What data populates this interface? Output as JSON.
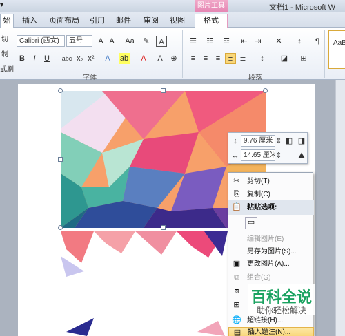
{
  "titlebar": {
    "quick_access": "▾",
    "context_tab": "图片工具",
    "doc_title": "文档1 - Microsoft W"
  },
  "tabs": [
    {
      "label": "始"
    },
    {
      "label": "插入"
    },
    {
      "label": "页面布局"
    },
    {
      "label": "引用"
    },
    {
      "label": "邮件"
    },
    {
      "label": "审阅"
    },
    {
      "label": "视图"
    },
    {
      "label": "格式"
    }
  ],
  "ribbon": {
    "clipboard": {
      "cut": "切",
      "copy": "制",
      "paint": "式刷"
    },
    "font": {
      "name": "Calibri (西文)",
      "size": "五号",
      "group_label": "字体"
    },
    "paragraph": {
      "group_label": "段落"
    },
    "styles": {
      "preview": "AaB"
    }
  },
  "mini_toolbar": {
    "height_value": "9.76 厘米",
    "width_value": "14.65 厘米"
  },
  "context_menu": {
    "items": [
      {
        "label": "剪切(T)",
        "icon": "scissors-icon",
        "glyph": "✂",
        "state": "normal"
      },
      {
        "label": "复制(C)",
        "icon": "copy-icon",
        "glyph": "⎘",
        "state": "normal"
      },
      {
        "label": "粘贴选项:",
        "icon": "paste-icon",
        "glyph": "📋",
        "state": "highlight"
      },
      {
        "label": "",
        "icon": "paste-picture-icon",
        "glyph": "▭",
        "state": "option"
      },
      {
        "label": "编辑图片(E)",
        "icon": "",
        "glyph": "",
        "state": "disabled"
      },
      {
        "label": "另存为图片(S)...",
        "icon": "",
        "glyph": "",
        "state": "normal"
      },
      {
        "label": "更改图片(A)...",
        "icon": "change-picture-icon",
        "glyph": "▣",
        "state": "normal"
      },
      {
        "label": "组合(G)",
        "icon": "group-icon",
        "glyph": "⧉",
        "state": "disabled"
      },
      {
        "label": "",
        "icon": "order-icon",
        "glyph": "⧈",
        "state": "normal"
      },
      {
        "label": "",
        "icon": "text-wrap-icon",
        "glyph": "⊞",
        "state": "normal"
      },
      {
        "label": "超链接(H)...",
        "icon": "hyperlink-icon",
        "glyph": "🌐",
        "state": "normal"
      },
      {
        "label": "插入题注(N)...",
        "icon": "caption-icon",
        "glyph": "▤",
        "state": "hover"
      }
    ]
  },
  "watermark": {
    "title": "百科全说",
    "subtitle": "助你轻松解决"
  },
  "colors": {
    "accent": "#2b579a",
    "context": "#e585b2",
    "watermark": "#1aa260"
  }
}
